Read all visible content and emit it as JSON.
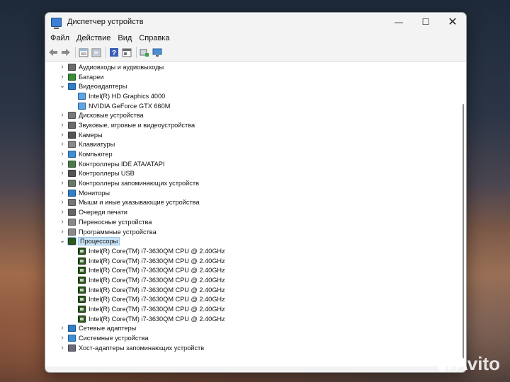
{
  "window": {
    "title": "Диспетчер устройств",
    "controls": {
      "minimize": "—",
      "maximize": "☐",
      "close": "✕"
    }
  },
  "menu": [
    "Файл",
    "Действие",
    "Вид",
    "Справка"
  ],
  "toolbar_icons": [
    "back-arrow-icon",
    "forward-arrow-icon",
    "properties-icon",
    "show-hidden-icon",
    "help-icon",
    "view-icon",
    "update-driver-icon",
    "monitor-icon"
  ],
  "tree": [
    {
      "label": "Аудиовходы и аудиовыходы",
      "level": 0,
      "expanded": false,
      "icon": "audio-icon",
      "color": "#6b6b6b"
    },
    {
      "label": "Батареи",
      "level": 0,
      "expanded": false,
      "icon": "battery-icon",
      "color": "#3a8a3a"
    },
    {
      "label": "Видеоадаптеры",
      "level": 0,
      "expanded": true,
      "icon": "display-adapter-icon",
      "color": "#2f7fc9"
    },
    {
      "label": "Intel(R) HD Graphics 4000",
      "level": 1,
      "icon": "gpu-icon",
      "color": "#5aa6e6"
    },
    {
      "label": "NVIDIA GeForce GTX 660M",
      "level": 1,
      "icon": "gpu-icon",
      "color": "#5aa6e6"
    },
    {
      "label": "Дисковые устройства",
      "level": 0,
      "expanded": false,
      "icon": "disk-icon",
      "color": "#7a7a7a"
    },
    {
      "label": "Звуковые, игровые и видеоустройства",
      "level": 0,
      "expanded": false,
      "icon": "sound-icon",
      "color": "#6b6b6b"
    },
    {
      "label": "Камеры",
      "level": 0,
      "expanded": false,
      "icon": "camera-icon",
      "color": "#555555"
    },
    {
      "label": "Клавиатуры",
      "level": 0,
      "expanded": false,
      "icon": "keyboard-icon",
      "color": "#8a8a8a"
    },
    {
      "label": "Компьютер",
      "level": 0,
      "expanded": false,
      "icon": "computer-icon",
      "color": "#3d8fd6"
    },
    {
      "label": "Контроллеры IDE ATA/ATAPI",
      "level": 0,
      "expanded": false,
      "icon": "ide-controller-icon",
      "color": "#4a7a4a"
    },
    {
      "label": "Контроллеры USB",
      "level": 0,
      "expanded": false,
      "icon": "usb-icon",
      "color": "#555555"
    },
    {
      "label": "Контроллеры запоминающих устройств",
      "level": 0,
      "expanded": false,
      "icon": "storage-controller-icon",
      "color": "#6a7a6a"
    },
    {
      "label": "Мониторы",
      "level": 0,
      "expanded": false,
      "icon": "monitor-icon",
      "color": "#2f7fc9"
    },
    {
      "label": "Мыши и иные указывающие устройства",
      "level": 0,
      "expanded": false,
      "icon": "mouse-icon",
      "color": "#777777"
    },
    {
      "label": "Очереди печати",
      "level": 0,
      "expanded": false,
      "icon": "printer-icon",
      "color": "#666666"
    },
    {
      "label": "Переносные устройства",
      "level": 0,
      "expanded": false,
      "icon": "portable-device-icon",
      "color": "#8a8a8a"
    },
    {
      "label": "Программные устройства",
      "level": 0,
      "expanded": false,
      "icon": "software-device-icon",
      "color": "#8a8a8a"
    },
    {
      "label": "Процессоры",
      "level": 0,
      "expanded": true,
      "selected": true,
      "icon": "processor-icon",
      "color": "#2d5a1e"
    },
    {
      "label": "Intel(R) Core(TM) i7-3630QM CPU @ 2.40GHz",
      "level": 1,
      "icon": "cpu-icon",
      "color": "#2d5a1e"
    },
    {
      "label": "Intel(R) Core(TM) i7-3630QM CPU @ 2.40GHz",
      "level": 1,
      "icon": "cpu-icon",
      "color": "#2d5a1e"
    },
    {
      "label": "Intel(R) Core(TM) i7-3630QM CPU @ 2.40GHz",
      "level": 1,
      "icon": "cpu-icon",
      "color": "#2d5a1e"
    },
    {
      "label": "Intel(R) Core(TM) i7-3630QM CPU @ 2.40GHz",
      "level": 1,
      "icon": "cpu-icon",
      "color": "#2d5a1e"
    },
    {
      "label": "Intel(R) Core(TM) i7-3630QM CPU @ 2.40GHz",
      "level": 1,
      "icon": "cpu-icon",
      "color": "#2d5a1e"
    },
    {
      "label": "Intel(R) Core(TM) i7-3630QM CPU @ 2.40GHz",
      "level": 1,
      "icon": "cpu-icon",
      "color": "#2d5a1e"
    },
    {
      "label": "Intel(R) Core(TM) i7-3630QM CPU @ 2.40GHz",
      "level": 1,
      "icon": "cpu-icon",
      "color": "#2d5a1e"
    },
    {
      "label": "Intel(R) Core(TM) i7-3630QM CPU @ 2.40GHz",
      "level": 1,
      "icon": "cpu-icon",
      "color": "#2d5a1e"
    },
    {
      "label": "Сетевые адаптеры",
      "level": 0,
      "expanded": false,
      "icon": "network-adapter-icon",
      "color": "#2f7fc9"
    },
    {
      "label": "Системные устройства",
      "level": 0,
      "expanded": false,
      "icon": "system-device-icon",
      "color": "#3d8fd6"
    },
    {
      "label": "Хост-адаптеры запоминающих устройств",
      "level": 0,
      "expanded": false,
      "icon": "storage-host-adapter-icon",
      "color": "#6a6a7a"
    }
  ],
  "watermark": "Avito"
}
